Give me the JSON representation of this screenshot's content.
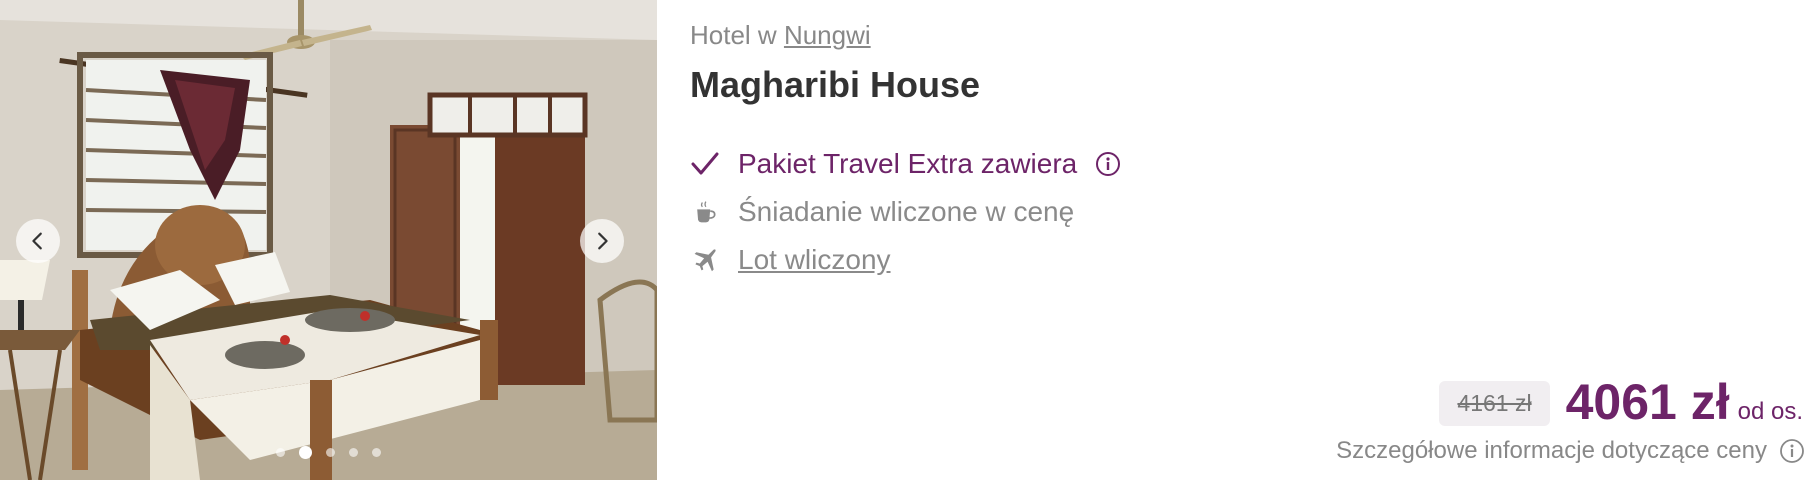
{
  "hotel": {
    "location_prefix": "Hotel w",
    "location_link": "Nungwi",
    "name": "Magharibi House"
  },
  "features": {
    "package_label": "Pakiet Travel Extra zawiera",
    "breakfast_label": "Śniadanie wliczone w cenę",
    "flight_label": "Lot wliczony"
  },
  "price": {
    "old": "4161 zł",
    "current": "4061 zł",
    "unit": "od os.",
    "details_link": "Szczegółowe informacje dotyczące ceny"
  },
  "gallery": {
    "active_slide": 2,
    "slide_count": 5
  },
  "colors": {
    "brand": "#6d2468",
    "muted": "#888888"
  },
  "icons": [
    "chevron-left-icon",
    "chevron-right-icon",
    "checkmark-icon",
    "info-icon",
    "coffee-cup-icon",
    "airplane-icon"
  ]
}
